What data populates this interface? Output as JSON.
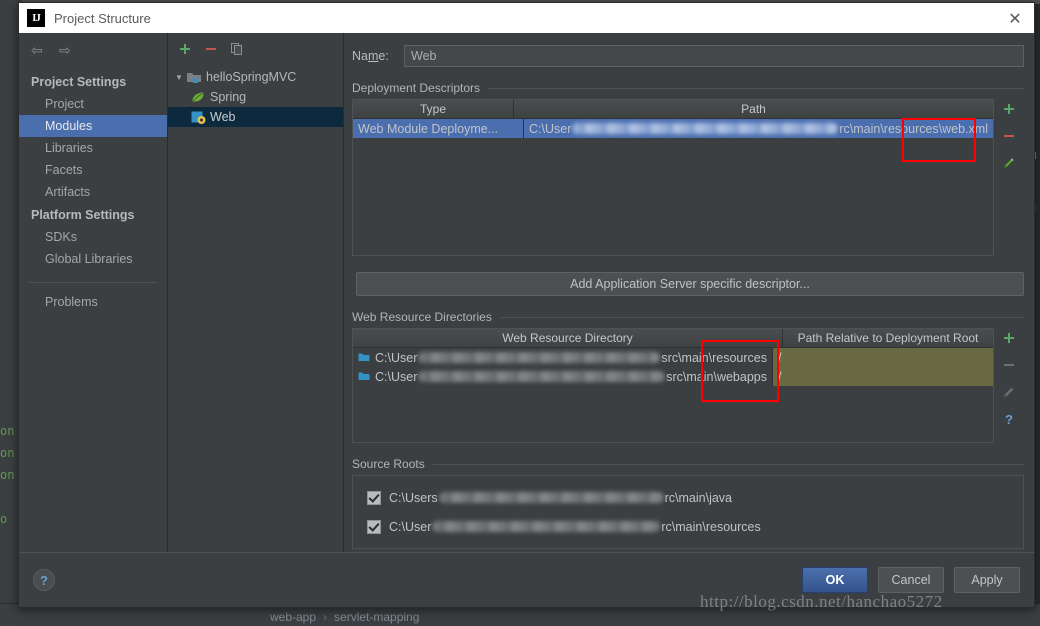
{
  "window": {
    "title": "Project Structure",
    "logo_text": "IJ",
    "close_label": "✕"
  },
  "sidebar": {
    "back_label": "⇦",
    "forward_label": "⇨",
    "groups": [
      {
        "title": "Project Settings",
        "items": [
          {
            "label": "Project",
            "selected": false
          },
          {
            "label": "Modules",
            "selected": true
          },
          {
            "label": "Libraries",
            "selected": false
          },
          {
            "label": "Facets",
            "selected": false
          },
          {
            "label": "Artifacts",
            "selected": false
          }
        ]
      },
      {
        "title": "Platform Settings",
        "items": [
          {
            "label": "SDKs",
            "selected": false
          },
          {
            "label": "Global Libraries",
            "selected": false
          }
        ]
      }
    ],
    "problems_label": "Problems"
  },
  "module_tree": {
    "toolbar": [
      {
        "name": "add-module-button",
        "label": "+"
      },
      {
        "name": "remove-module-button",
        "label": "−"
      },
      {
        "name": "copy-module-button",
        "label": "⧉"
      }
    ],
    "nodes": [
      {
        "label": "helloSpringMVC",
        "level": 0,
        "expanded": true,
        "icon": "module-folder-icon",
        "selected": false
      },
      {
        "label": "Spring",
        "level": 1,
        "expanded": false,
        "icon": "spring-leaf-icon",
        "selected": false
      },
      {
        "label": "Web",
        "level": 1,
        "expanded": false,
        "icon": "web-facet-icon",
        "selected": true
      }
    ]
  },
  "main": {
    "name_label_pre": "Na",
    "name_label_mnemonic": "m",
    "name_label_post": "e:",
    "name_value": "Web",
    "name_placeholder": "",
    "deployment_descriptors": {
      "title": "Deployment Descriptors",
      "columns": [
        "Type",
        "Path"
      ],
      "rows": [
        {
          "type": "Web Module Deployme...",
          "path_prefix": "C:\\User",
          "path_masked": true,
          "path_suffix": "rc\\main\\resources\\web.xml",
          "selected": true
        }
      ],
      "actions": [
        {
          "name": "add-descriptor-button",
          "glyph": "+",
          "enabled": true
        },
        {
          "name": "remove-descriptor-button",
          "glyph": "−",
          "enabled": true
        },
        {
          "name": "edit-descriptor-button",
          "glyph": "✎",
          "enabled": true
        }
      ]
    },
    "add_descriptor_button": "Add Application Server specific descriptor...",
    "web_resource_directories": {
      "title": "Web Resource Directories",
      "columns": [
        "Web Resource Directory",
        "Path Relative to Deployment Root"
      ],
      "rows": [
        {
          "dir_prefix": "C:\\User",
          "dir_suffix": "src\\main\\resources",
          "relative_path": "/"
        },
        {
          "dir_prefix": "C:\\User",
          "dir_suffix": "src\\main\\webapps",
          "relative_path": "/"
        }
      ],
      "actions": [
        {
          "name": "add-web-resource-button",
          "glyph": "+",
          "enabled": true
        },
        {
          "name": "remove-web-resource-button",
          "glyph": "−",
          "enabled": false
        },
        {
          "name": "edit-web-resource-button",
          "glyph": "✎",
          "enabled": false
        },
        {
          "name": "web-resource-help-button",
          "glyph": "?",
          "enabled": true
        }
      ]
    },
    "source_roots": {
      "title": "Source Roots",
      "rows": [
        {
          "checked": true,
          "prefix": "C:\\Users",
          "suffix": "rc\\main\\java"
        },
        {
          "checked": true,
          "prefix": "C:\\User",
          "suffix": "rc\\main\\resources"
        }
      ]
    }
  },
  "footer": {
    "help_label": "?",
    "buttons": [
      {
        "name": "ok-button",
        "label": "OK",
        "default": true
      },
      {
        "name": "cancel-button",
        "label": "Cancel",
        "default": false
      },
      {
        "name": "apply-button",
        "label": "Apply",
        "default": false
      }
    ]
  },
  "background": {
    "breadcrumb_a": "web-app",
    "breadcrumb_sep": "›",
    "breadcrumb_b": "servlet-mapping",
    "code_fragments": [
      "on",
      "on",
      "on",
      "o"
    ],
    "right_token": "a"
  },
  "watermark": "http://blog.csdn.net/hanchao5272",
  "colors": {
    "dialog_bg": "#3c3f41",
    "selection_blue": "#4b6eaf",
    "tree_selection": "#0d293e",
    "olive_cell": "#6a6a42",
    "annotation_red": "#ff0000",
    "accent_green": "#499c54",
    "titlebar_bg": "#ffffff"
  }
}
